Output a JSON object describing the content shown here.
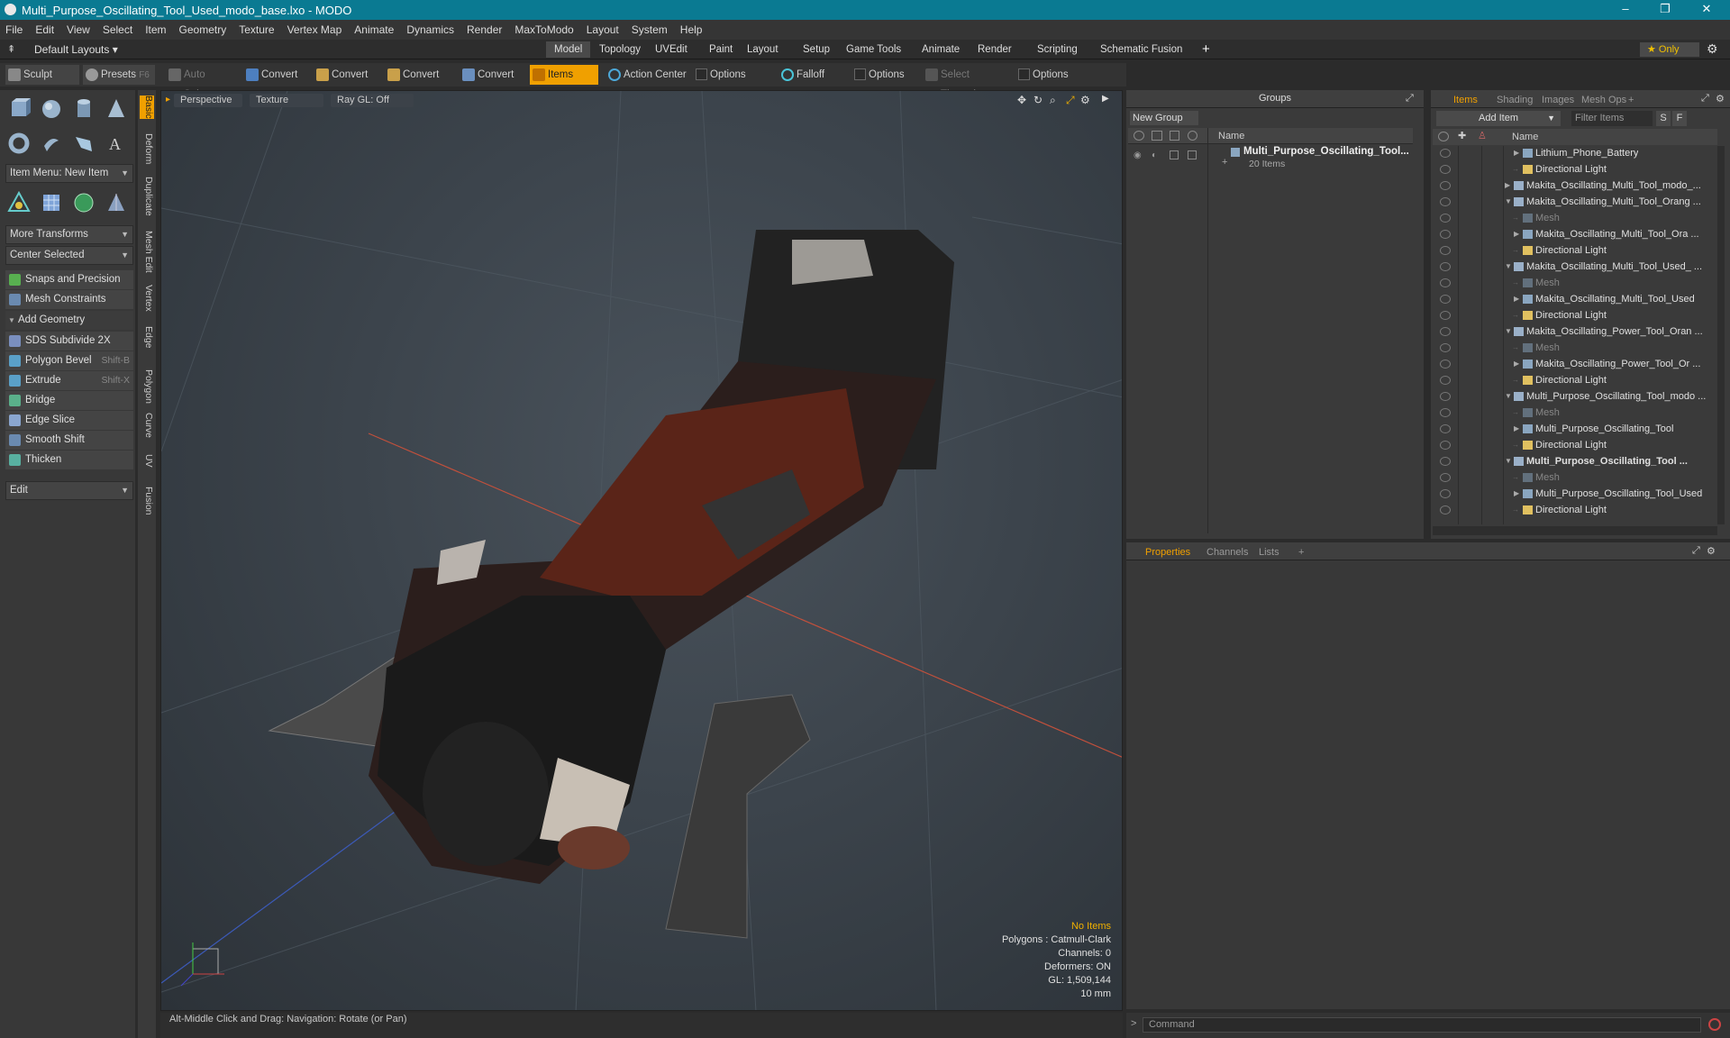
{
  "titlebar": {
    "title": "Multi_Purpose_Oscillating_Tool_Used_modo_base.lxo - MODO",
    "minimize": "–",
    "restore": "❐",
    "close": "✕"
  },
  "menu": [
    "File",
    "Edit",
    "View",
    "Select",
    "Item",
    "Geometry",
    "Texture",
    "Vertex Map",
    "Animate",
    "Dynamics",
    "Render",
    "MaxToModo",
    "Layout",
    "System",
    "Help"
  ],
  "layouts": {
    "current": "Default Layouts ▾",
    "tabs": [
      "Model",
      "Topology",
      "UVEdit",
      "Paint",
      "Layout",
      "Setup",
      "Game Tools",
      "Animate",
      "Render",
      "Scripting",
      "Schematic Fusion"
    ],
    "active": "Model",
    "add": "+",
    "only_label": "★  Only",
    "gear": "⚙"
  },
  "toolbar": {
    "sculpt": "Sculpt",
    "presets": "Presets",
    "presets_key": "F6",
    "auto_select": "Auto Select",
    "convert1": "Convert",
    "convert2": "Convert",
    "convert3": "Convert",
    "convert4": "Convert",
    "items": "Items",
    "action_center": "Action Center",
    "options1": "Options",
    "falloff": "Falloff",
    "options2": "Options",
    "select_through": "Select Through",
    "options3": "Options"
  },
  "left": {
    "item_menu": "Item Menu: New Item",
    "more_transforms": "More Transforms",
    "center_selected": "Center Selected",
    "snaps": "Snaps and Precision",
    "mesh_constraints": "Mesh Constraints",
    "add_geometry": "Add Geometry",
    "tools": [
      {
        "label": "SDS Subdivide 2X",
        "key": ""
      },
      {
        "label": "Polygon Bevel",
        "key": "Shift-B"
      },
      {
        "label": "Extrude",
        "key": "Shift-X"
      },
      {
        "label": "Bridge",
        "key": ""
      },
      {
        "label": "Edge Slice",
        "key": ""
      },
      {
        "label": "Smooth Shift",
        "key": ""
      },
      {
        "label": "Thicken",
        "key": ""
      }
    ],
    "edit": "Edit"
  },
  "vtabs": [
    "Basic",
    "Deform",
    "Duplicate",
    "Mesh Edit",
    "Vertex",
    "Edge",
    "Polygon",
    "Curve",
    "UV",
    "Fusion"
  ],
  "viewport": {
    "view": "Perspective",
    "shading": "Texture",
    "raygl": "Ray GL: Off",
    "stats": {
      "selection": "No Items",
      "polygons": "Polygons : Catmull-Clark",
      "channels": "Channels: 0",
      "deformers": "Deformers: ON",
      "gl": "GL: 1,509,144",
      "scale": "10 mm"
    }
  },
  "statusbar": {
    "hint": "Alt-Middle Click and Drag:   Navigation: Rotate (or Pan)"
  },
  "groups": {
    "title": "Groups",
    "new_group": "New Group",
    "col_name": "Name",
    "group_name": "Multi_Purpose_Oscillating_Tool...",
    "group_count": "20 Items"
  },
  "items": {
    "tabs": [
      "Items",
      "Shading",
      "Images",
      "Mesh Ops",
      "+"
    ],
    "add_item": "Add Item",
    "filter": "Filter Items",
    "s": "S",
    "f": "F",
    "col_name": "Name",
    "rows": [
      {
        "label": "Lithium_Phone_Battery",
        "indent": 2,
        "exp": "▶",
        "kind": "mesh",
        "bold": false,
        "dim": false
      },
      {
        "label": "Directional Light",
        "indent": 2,
        "exp": "",
        "kind": "light",
        "bold": false,
        "dim": false
      },
      {
        "label": "Makita_Oscillating_Multi_Tool_modo_...",
        "indent": 1,
        "exp": "▶",
        "kind": "scene",
        "bold": false,
        "dim": false
      },
      {
        "label": "Makita_Oscillating_Multi_Tool_Orang ...",
        "indent": 1,
        "exp": "▼",
        "kind": "scene",
        "bold": false,
        "dim": false
      },
      {
        "label": "Mesh",
        "indent": 2,
        "exp": "",
        "kind": "mesh",
        "bold": false,
        "dim": true
      },
      {
        "label": "Makita_Oscillating_Multi_Tool_Ora ...",
        "indent": 2,
        "exp": "▶",
        "kind": "mesh",
        "bold": false,
        "dim": false
      },
      {
        "label": "Directional Light",
        "indent": 2,
        "exp": "",
        "kind": "light",
        "bold": false,
        "dim": false
      },
      {
        "label": "Makita_Oscillating_Multi_Tool_Used_ ...",
        "indent": 1,
        "exp": "▼",
        "kind": "scene",
        "bold": false,
        "dim": false
      },
      {
        "label": "Mesh",
        "indent": 2,
        "exp": "",
        "kind": "mesh",
        "bold": false,
        "dim": true
      },
      {
        "label": "Makita_Oscillating_Multi_Tool_Used",
        "indent": 2,
        "exp": "▶",
        "kind": "mesh",
        "bold": false,
        "dim": false
      },
      {
        "label": "Directional Light",
        "indent": 2,
        "exp": "",
        "kind": "light",
        "bold": false,
        "dim": false
      },
      {
        "label": "Makita_Oscillating_Power_Tool_Oran ...",
        "indent": 1,
        "exp": "▼",
        "kind": "scene",
        "bold": false,
        "dim": false
      },
      {
        "label": "Mesh",
        "indent": 2,
        "exp": "",
        "kind": "mesh",
        "bold": false,
        "dim": true
      },
      {
        "label": "Makita_Oscillating_Power_Tool_Or ...",
        "indent": 2,
        "exp": "▶",
        "kind": "mesh",
        "bold": false,
        "dim": false
      },
      {
        "label": "Directional Light",
        "indent": 2,
        "exp": "",
        "kind": "light",
        "bold": false,
        "dim": false
      },
      {
        "label": "Multi_Purpose_Oscillating_Tool_modo ...",
        "indent": 1,
        "exp": "▼",
        "kind": "scene",
        "bold": false,
        "dim": false
      },
      {
        "label": "Mesh",
        "indent": 2,
        "exp": "",
        "kind": "mesh",
        "bold": false,
        "dim": true
      },
      {
        "label": "Multi_Purpose_Oscillating_Tool",
        "indent": 2,
        "exp": "▶",
        "kind": "mesh",
        "bold": false,
        "dim": false
      },
      {
        "label": "Directional Light",
        "indent": 2,
        "exp": "",
        "kind": "light",
        "bold": false,
        "dim": false
      },
      {
        "label": "Multi_Purpose_Oscillating_Tool ...",
        "indent": 1,
        "exp": "▼",
        "kind": "scene",
        "bold": true,
        "dim": false
      },
      {
        "label": "Mesh",
        "indent": 2,
        "exp": "",
        "kind": "mesh",
        "bold": false,
        "dim": true
      },
      {
        "label": "Multi_Purpose_Oscillating_Tool_Used",
        "indent": 2,
        "exp": "▶",
        "kind": "mesh",
        "bold": false,
        "dim": false
      },
      {
        "label": "Directional Light",
        "indent": 2,
        "exp": "",
        "kind": "light",
        "bold": false,
        "dim": false
      }
    ]
  },
  "properties": {
    "tabs": [
      "Properties",
      "Channels",
      "Lists",
      "+"
    ]
  },
  "command": {
    "placeholder": "Command",
    "prompt": ">"
  },
  "colors": {
    "accent": "#f0a000",
    "titlebar": "#0a7a92"
  }
}
